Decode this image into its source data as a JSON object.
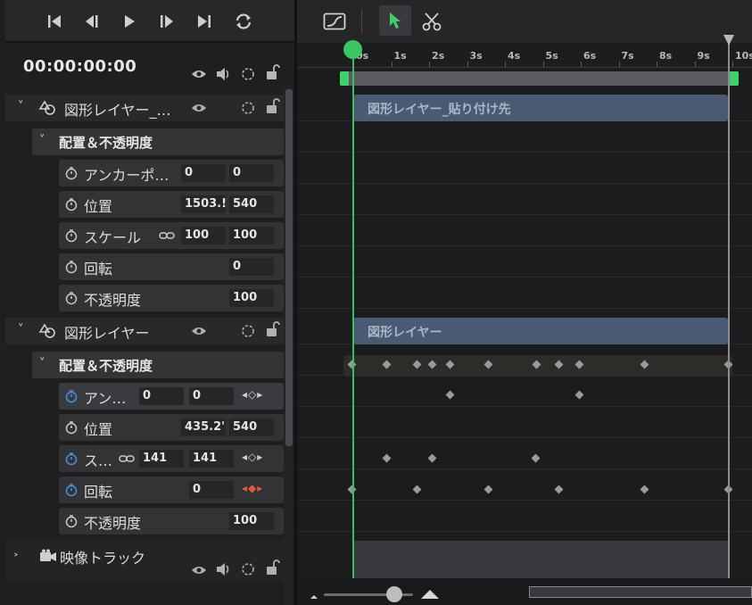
{
  "transport": {
    "buttons": [
      "skip-to-start-icon",
      "step-back-icon",
      "play-icon",
      "step-forward-icon",
      "skip-to-end-icon",
      "loop-icon"
    ]
  },
  "timecode": "00:00:00:00",
  "layers": [
    {
      "name": "図形レイヤー_…",
      "group": "配置＆不透明度",
      "props": [
        {
          "label": "アンカーポ…",
          "v1": "0",
          "v2": "0"
        },
        {
          "label": "位置",
          "v1": "1503.!",
          "v2": "540"
        },
        {
          "label": "スケール",
          "v1": "100",
          "v2": "100"
        },
        {
          "label": "回転",
          "v2": "0"
        },
        {
          "label": "不透明度",
          "v2": "100"
        }
      ]
    },
    {
      "name": "図形レイヤー",
      "group": "配置＆不透明度",
      "props": [
        {
          "label": "アン…",
          "v1": "0",
          "v2": "0",
          "kf": "◂◇▸"
        },
        {
          "label": "位置",
          "v1": "435.2'",
          "v2": "540"
        },
        {
          "label": "ス…",
          "v1": "141",
          "v2": "141",
          "kf": "◂◇▸"
        },
        {
          "label": "回転",
          "v1": "0",
          "kf": "◂◆▸"
        },
        {
          "label": "不透明度",
          "v2": "100"
        }
      ]
    }
  ],
  "video_track": {
    "name": "映像トラック"
  },
  "timeline": {
    "ticks": [
      "0s",
      "1s",
      "2s",
      "3s",
      "4s",
      "5s",
      "6s",
      "7s",
      "8s",
      "9s",
      "10s"
    ],
    "clips": [
      "図形レイヤー_貼り付け先",
      "図形レイヤー"
    ]
  },
  "colors": {
    "accent_green": "#38c764",
    "clip_blue": "#4a5a72",
    "keyframe_active": "#e05a3c"
  }
}
